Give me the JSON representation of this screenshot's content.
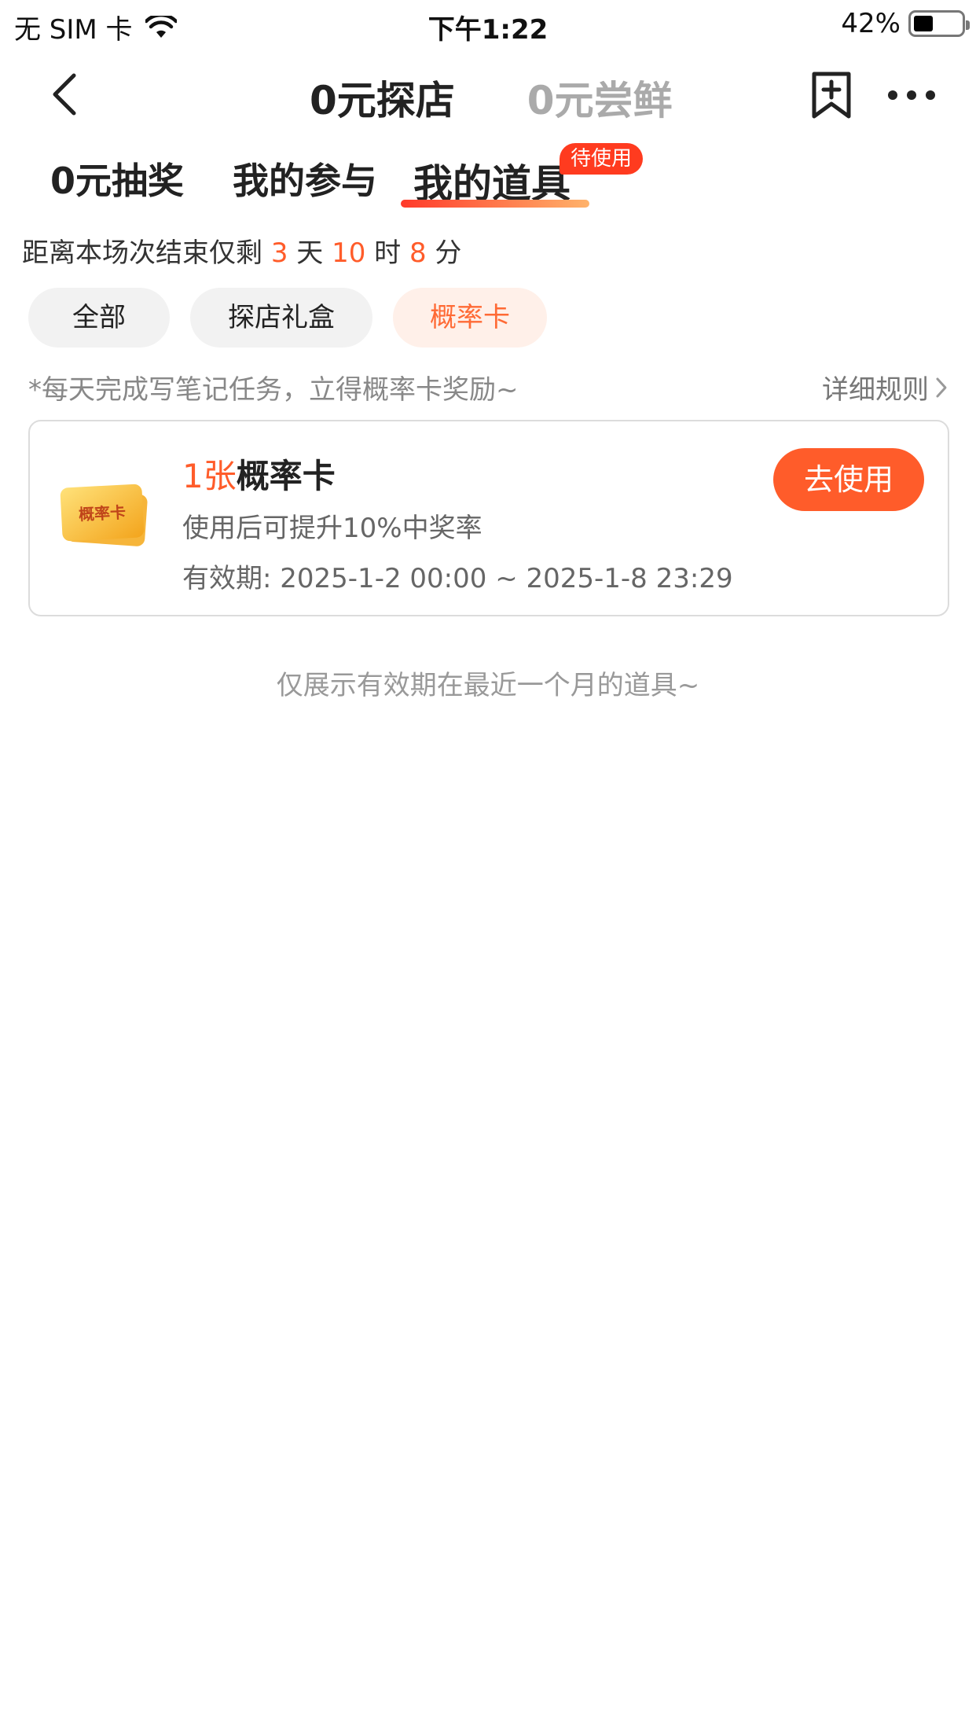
{
  "status_bar": {
    "carrier": "无 SIM 卡",
    "time": "下午1:22",
    "battery_percent": "42%",
    "battery_level": 0.42
  },
  "nav": {
    "tabs": [
      {
        "label": "0元探店",
        "active": true
      },
      {
        "label": "0元尝鲜",
        "active": false
      }
    ]
  },
  "sub_tabs": {
    "items": [
      {
        "label": "0元抽奖"
      },
      {
        "label": "我的参与"
      },
      {
        "label": "我的道具"
      }
    ],
    "badge": "待使用"
  },
  "countdown": {
    "prefix": "距离本场次结束仅剩",
    "days": "3",
    "days_unit": "天",
    "hours": "10",
    "hours_unit": "时",
    "minutes": "8",
    "minutes_unit": "分"
  },
  "filters": {
    "chips": [
      {
        "label": "全部"
      },
      {
        "label": "探店礼盒"
      },
      {
        "label": "概率卡",
        "selected": true
      }
    ]
  },
  "tip": {
    "text": "*每天完成写笔记任务，立得概率卡奖励~",
    "rules_link": "详细规则"
  },
  "card": {
    "icon_text": "概率卡",
    "quantity": "1张",
    "name": "概率卡",
    "description": "使用后可提升10%中奖率",
    "validity": "有效期: 2025-1-2 00:00 ~ 2025-1-8 23:29",
    "use_button": "去使用"
  },
  "footer_note": "仅展示有效期在最近一个月的道具~",
  "colors": {
    "accent": "#ff5c2a",
    "badge": "#ff3b1f",
    "chip_selected_bg": "#fff0e9"
  }
}
